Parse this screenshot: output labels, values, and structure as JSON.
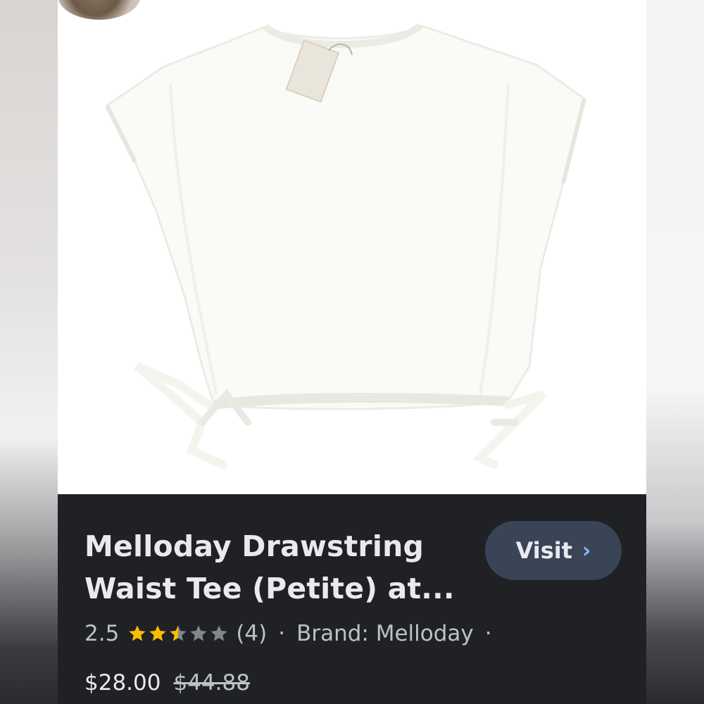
{
  "product": {
    "title_line1": "Melloday Drawstring",
    "title_line2": "Waist Tee (Petite) at...",
    "visit_label": "Visit",
    "visit_chevron": "›",
    "rating_value": "2.5",
    "rating_stars": 2.5,
    "rating_count": "(4)",
    "separator": "·",
    "brand": "Brand: Melloday",
    "price": "$28.00",
    "original_price": "$44.88"
  },
  "icons": {
    "star": "star-icon",
    "chevron": "chevron-right-icon"
  },
  "colors": {
    "panel_bg": "#202124",
    "button_bg": "#394457",
    "star_filled": "#fbbc04",
    "star_empty": "#80868b",
    "chevron": "#8ab4f8"
  }
}
